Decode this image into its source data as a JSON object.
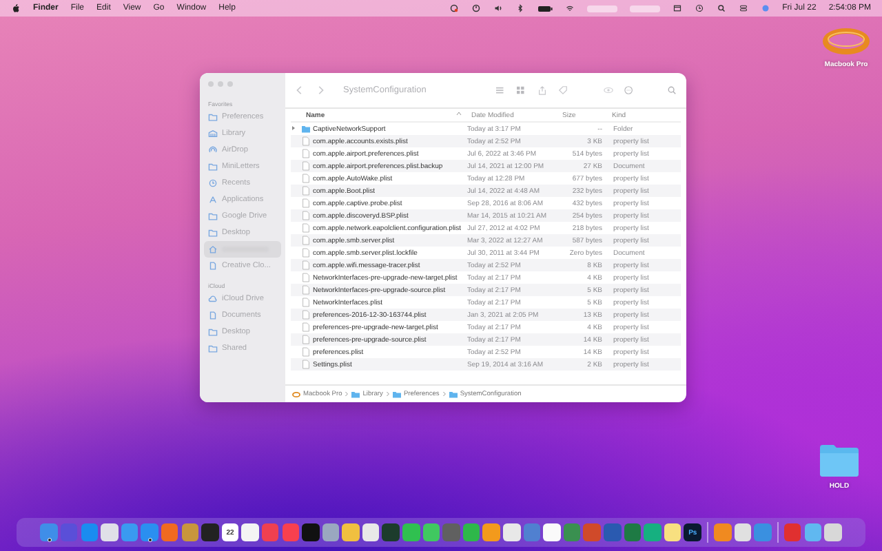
{
  "menu_bar": {
    "app": "Finder",
    "items": [
      "File",
      "Edit",
      "View",
      "Go",
      "Window",
      "Help"
    ],
    "date": "Fri Jul 22",
    "time": "2:54:08 PM"
  },
  "desktop_icons": [
    {
      "kind": "ring",
      "label": "Macbook Pro"
    },
    {
      "kind": "folder",
      "label": "HOLD"
    }
  ],
  "window": {
    "title": "SystemConfiguration",
    "sidebar": [
      {
        "heading": "Favorites",
        "items": [
          {
            "label": "Preferences",
            "kind": "folder",
            "selected": false
          },
          {
            "label": "Library",
            "kind": "building",
            "selected": false
          },
          {
            "label": "AirDrop",
            "kind": "airdrop",
            "selected": false
          },
          {
            "label": "MiniLetters",
            "kind": "folder",
            "selected": false
          },
          {
            "label": "Recents",
            "kind": "clock",
            "selected": false
          },
          {
            "label": "Applications",
            "kind": "apps",
            "selected": false
          },
          {
            "label": "Google Drive",
            "kind": "folder",
            "selected": false
          },
          {
            "label": "Desktop",
            "kind": "folder",
            "selected": false
          },
          {
            "kind": "house",
            "selected": true
          },
          {
            "label": "Creative Clo...",
            "kind": "doc",
            "selected": false
          }
        ]
      },
      {
        "heading": "iCloud",
        "items": [
          {
            "label": "iCloud Drive",
            "kind": "cloud",
            "selected": false
          },
          {
            "label": "Documents",
            "kind": "doc",
            "selected": false
          },
          {
            "label": "Desktop",
            "kind": "folder",
            "selected": false
          },
          {
            "label": "Shared",
            "kind": "folder",
            "selected": false
          }
        ]
      }
    ],
    "columns": [
      "Name",
      "Date Modified",
      "Size",
      "Kind"
    ],
    "rows": [
      {
        "kind": "folder",
        "name": "CaptiveNetworkSupport",
        "date": "Today at 3:17 PM",
        "size": "--",
        "type": "Folder"
      },
      {
        "kind": "file",
        "name": "com.apple.accounts.exists.plist",
        "date": "Today at 2:52 PM",
        "size": "3 KB",
        "type": "property list"
      },
      {
        "kind": "file",
        "name": "com.apple.airport.preferences.plist",
        "date": "Jul 6, 2022 at 3:46 PM",
        "size": "514 bytes",
        "type": "property list"
      },
      {
        "kind": "file",
        "name": "com.apple.airport.preferences.plist.backup",
        "date": "Jul 14, 2021 at 12:00 PM",
        "size": "27 KB",
        "type": "Document"
      },
      {
        "kind": "file",
        "name": "com.apple.AutoWake.plist",
        "date": "Today at 12:28 PM",
        "size": "677 bytes",
        "type": "property list"
      },
      {
        "kind": "file",
        "name": "com.apple.Boot.plist",
        "date": "Jul 14, 2022 at 4:48 AM",
        "size": "232 bytes",
        "type": "property list"
      },
      {
        "kind": "file",
        "name": "com.apple.captive.probe.plist",
        "date": "Sep 28, 2016 at 8:06 AM",
        "size": "432 bytes",
        "type": "property list"
      },
      {
        "kind": "file",
        "name": "com.apple.discoveryd.BSP.plist",
        "date": "Mar 14, 2015 at 10:21 AM",
        "size": "254 bytes",
        "type": "property list"
      },
      {
        "kind": "file",
        "name": "com.apple.network.eapolclient.configuration.plist",
        "date": "Jul 27, 2012 at 4:02 PM",
        "size": "218 bytes",
        "type": "property list"
      },
      {
        "kind": "file",
        "name": "com.apple.smb.server.plist",
        "date": "Mar 3, 2022 at 12:27 AM",
        "size": "587 bytes",
        "type": "property list"
      },
      {
        "kind": "file",
        "name": "com.apple.smb.server.plist.lockfile",
        "date": "Jul 30, 2011 at 3:44 PM",
        "size": "Zero bytes",
        "type": "Document"
      },
      {
        "kind": "file",
        "name": "com.apple.wifi.message-tracer.plist",
        "date": "Today at 2:52 PM",
        "size": "8 KB",
        "type": "property list"
      },
      {
        "kind": "file",
        "name": "NetworkInterfaces-pre-upgrade-new-target.plist",
        "date": "Today at 2:17 PM",
        "size": "4 KB",
        "type": "property list"
      },
      {
        "kind": "file",
        "name": "NetworkInterfaces-pre-upgrade-source.plist",
        "date": "Today at 2:17 PM",
        "size": "5 KB",
        "type": "property list"
      },
      {
        "kind": "file",
        "name": "NetworkInterfaces.plist",
        "date": "Today at 2:17 PM",
        "size": "5 KB",
        "type": "property list"
      },
      {
        "kind": "file",
        "name": "preferences-2016-12-30-163744.plist",
        "date": "Jan 3, 2021 at 2:05 PM",
        "size": "13 KB",
        "type": "property list"
      },
      {
        "kind": "file",
        "name": "preferences-pre-upgrade-new-target.plist",
        "date": "Today at 2:17 PM",
        "size": "4 KB",
        "type": "property list"
      },
      {
        "kind": "file",
        "name": "preferences-pre-upgrade-source.plist",
        "date": "Today at 2:17 PM",
        "size": "14 KB",
        "type": "property list"
      },
      {
        "kind": "file",
        "name": "preferences.plist",
        "date": "Today at 2:52 PM",
        "size": "14 KB",
        "type": "property list"
      },
      {
        "kind": "file",
        "name": "Settings.plist",
        "date": "Sep 19, 2014 at 3:16 AM",
        "size": "2 KB",
        "type": "property list"
      }
    ],
    "path": [
      {
        "kind": "disk",
        "label": "Macbook Pro"
      },
      {
        "kind": "folder",
        "label": "Library"
      },
      {
        "kind": "folder",
        "label": "Preferences"
      },
      {
        "kind": "folder",
        "label": "SystemConfiguration"
      }
    ]
  },
  "dock": [
    {
      "color": "#3f8ee8",
      "running": true
    },
    {
      "color": "#5a4fd8",
      "running": false
    },
    {
      "color": "#1a8cf0",
      "running": false
    },
    {
      "color": "#e0e0e8",
      "running": false
    },
    {
      "color": "#3a9af0",
      "running": false
    },
    {
      "color": "#2a8ff0",
      "running": true
    },
    {
      "color": "#f06a20",
      "running": false
    },
    {
      "color": "#c8963c",
      "running": false
    },
    {
      "color": "#222222",
      "running": false
    },
    {
      "color": "#ffffff",
      "running": false,
      "label": "22"
    },
    {
      "color": "#f4f4f4",
      "running": false
    },
    {
      "color": "#f04050",
      "running": false
    },
    {
      "color": "#f8404e",
      "running": false
    },
    {
      "color": "#111111",
      "running": false
    },
    {
      "color": "#9aa8c0",
      "running": false
    },
    {
      "color": "#f0c040",
      "running": false
    },
    {
      "color": "#e8e8e8",
      "running": false
    },
    {
      "color": "#1c3c2c",
      "running": false
    },
    {
      "color": "#30c050",
      "running": false
    },
    {
      "color": "#40c860",
      "running": false
    },
    {
      "color": "#606060",
      "running": false
    },
    {
      "color": "#2eb84a",
      "running": false
    },
    {
      "color": "#f39a1c",
      "running": false
    },
    {
      "color": "#e8e8e8",
      "running": false
    },
    {
      "color": "#5080d0",
      "running": false
    },
    {
      "color": "#fafafa",
      "running": false
    },
    {
      "color": "#3a9050",
      "running": false
    },
    {
      "color": "#d04a2a",
      "running": false
    },
    {
      "color": "#2a5ab0",
      "running": false
    },
    {
      "color": "#1e7a44",
      "running": false
    },
    {
      "color": "#16b080",
      "running": false
    },
    {
      "color": "#f8e080",
      "running": false
    },
    {
      "color": "#0a1a30",
      "running": false,
      "label": "Ps"
    },
    {
      "kind": "separator"
    },
    {
      "color": "#f08a20",
      "running": false
    },
    {
      "color": "#e0e0e0",
      "running": false
    },
    {
      "color": "#3a90e0",
      "running": false
    },
    {
      "kind": "separator"
    },
    {
      "color": "#e03030",
      "running": false
    },
    {
      "color": "#60b8f0",
      "running": false
    },
    {
      "color": "#d8d8d8",
      "running": false
    }
  ]
}
